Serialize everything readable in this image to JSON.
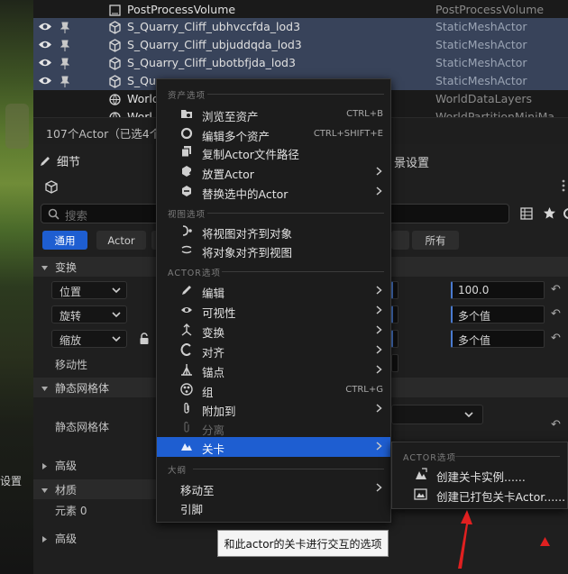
{
  "viewport": {
    "side_label": "设置"
  },
  "outliner": {
    "rows": [
      {
        "name": "PostProcessVolume",
        "type": "PostProcessVolume",
        "selected": false
      },
      {
        "name": "S_Quarry_Cliff_ubhvccfda_lod3",
        "type": "StaticMeshActor",
        "selected": true
      },
      {
        "name": "S_Quarry_Cliff_ubjuddqda_lod3",
        "type": "StaticMeshActor",
        "selected": true
      },
      {
        "name": "S_Quarry_Cliff_ubotbfjda_lod3",
        "type": "StaticMeshActor",
        "selected": true
      },
      {
        "name": "S_Qua",
        "type": "StaticMeshActor",
        "selected": true
      },
      {
        "name": "World",
        "type": "WorldDataLayers",
        "selected": false
      },
      {
        "name": "Worl",
        "type": "WorldPartitionMiniMa",
        "selected": false
      }
    ],
    "count_text": "107个Actor（已选4个"
  },
  "details": {
    "tab_label": "细节",
    "world_settings_fragment": "景设置",
    "search_placeholder": "搜索",
    "filter_tabs": [
      "通用",
      "Actor",
      "",
      "",
      "所有"
    ],
    "transform_section": "变换",
    "location_label": "位置",
    "rotation_label": "旋转",
    "scale_label": "缩放",
    "mobility_label": "移动性",
    "location_value": "100.0",
    "rotation_value": "多个值",
    "scale_value": "多个值",
    "static_mesh_section": "静态网格体",
    "static_mesh_label": "静态网格体",
    "advanced_label": "高级",
    "materials_section": "材质",
    "element0_label": "元素 0",
    "advanced_label_2": "高级"
  },
  "context_menu": {
    "sections": {
      "asset": "资产选项",
      "view": "视图选项",
      "actor": "ACTOR选项",
      "hierarchy": "大纲"
    },
    "asset_items": [
      {
        "label": "浏览至资产",
        "shortcut": "CTRL+B",
        "icon": "browse-icon"
      },
      {
        "label": "编辑多个资产",
        "shortcut": "CTRL+SHIFT+E",
        "icon": "circle-icon"
      },
      {
        "label": "复制Actor文件路径",
        "shortcut": "",
        "icon": "copy-path-icon"
      },
      {
        "label": "放置Actor",
        "shortcut": "",
        "icon": "place-actor-icon",
        "submenu": true
      },
      {
        "label": "替换选中的Actor",
        "shortcut": "",
        "icon": "replace-icon",
        "submenu": true
      }
    ],
    "view_items": [
      {
        "label": "将视图对齐到对象",
        "icon": "align-view-icon"
      },
      {
        "label": "将对象对齐到视图",
        "icon": "align-object-icon"
      }
    ],
    "actor_items": [
      {
        "label": "编辑",
        "icon": "pencil-icon",
        "submenu": true
      },
      {
        "label": "可视性",
        "icon": "eye-icon",
        "submenu": true
      },
      {
        "label": "变换",
        "icon": "transform-icon",
        "submenu": true
      },
      {
        "label": "对齐",
        "icon": "snap-icon",
        "submenu": true
      },
      {
        "label": "锚点",
        "icon": "pivot-icon",
        "submenu": true
      },
      {
        "label": "组",
        "shortcut": "CTRL+G",
        "icon": "group-icon"
      },
      {
        "label": "附加到",
        "icon": "paperclip-icon",
        "submenu": true
      },
      {
        "label": "分离",
        "icon": "detach-icon",
        "disabled": true
      },
      {
        "label": "关卡",
        "icon": "level-icon",
        "submenu": true,
        "highlighted": true
      }
    ],
    "hierarchy_items": [
      {
        "label": "移动至",
        "submenu": true
      },
      {
        "label": "引脚",
        "submenu": false
      }
    ]
  },
  "submenu": {
    "header": "ACTOR选项",
    "items": [
      {
        "label": "创建关卡实例......",
        "icon": "level-instance-icon"
      },
      {
        "label": "创建已打包关卡Actor......",
        "icon": "packed-level-icon"
      }
    ]
  },
  "tooltip": {
    "text": "和此actor的关卡进行交互的选项"
  },
  "colors": {
    "accent": "#1e5ed1",
    "selection": "#38435a",
    "annotation_arrow": "#e02020"
  }
}
